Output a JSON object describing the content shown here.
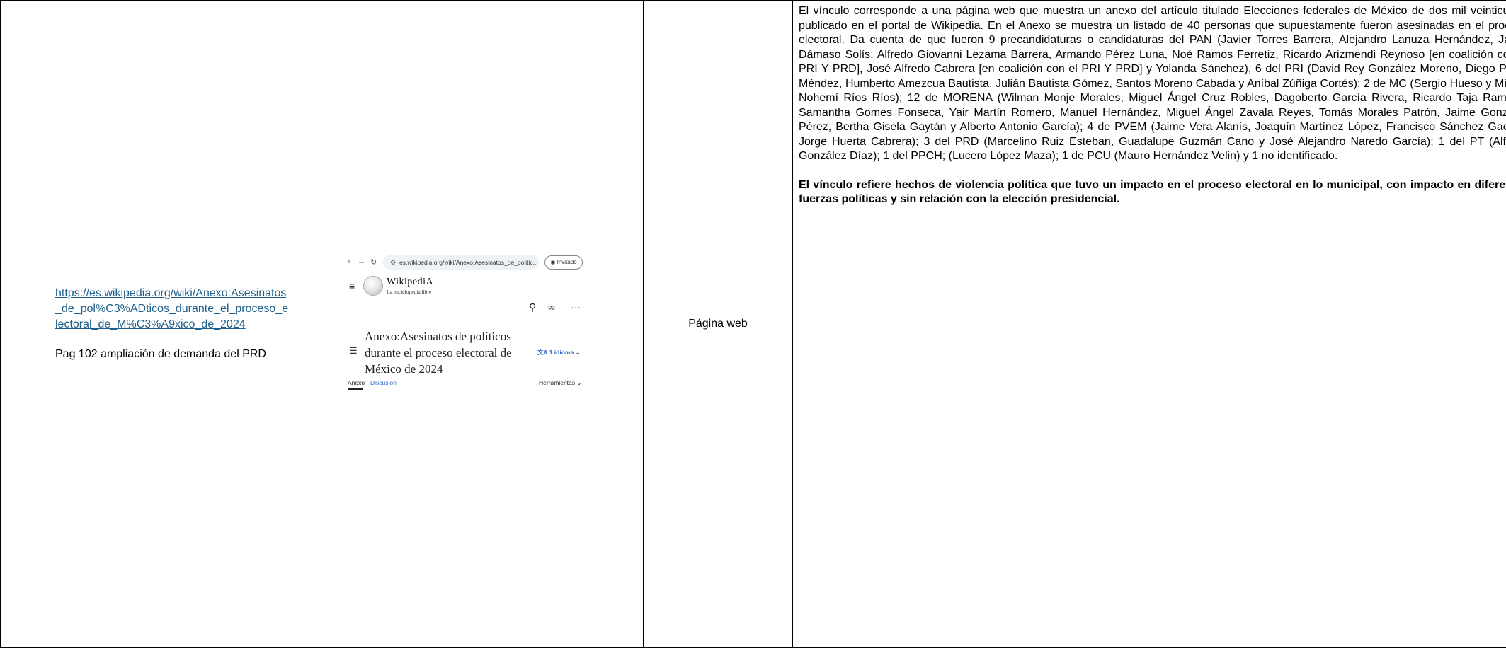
{
  "row": {
    "source_link": "https://es.wikipedia.org/wiki/Anexo:Asesinatos_de_pol%C3%ADticos_durante_el_proceso_electoral_de_M%C3%A9xico_de_2024",
    "source_note": "Pag 102 ampliación de demanda del PRD",
    "type": "Página web",
    "description": "El vínculo corresponde a una página web que muestra un anexo del artículo titulado Elecciones federales de México de dos mil veinticuatro publicado en el portal de Wikipedia. En el Anexo se muestra un listado de 40 personas que supuestamente fueron asesinadas en el proceso electoral. Da cuenta de que fueron 9 precandidaturas o candidaturas del PAN (Javier Torres Barrera, Alejandro Lanuza Hernández, Jaime Dámaso Solís, Alfredo Giovanni Lezama Barrera, Armando Pérez Luna, Noé Ramos Ferretiz, Ricardo Arizmendi Reynoso [en coalición con el PRI Y PRD], José Alfredo Cabrera [en coalición con el PRI Y PRD] y Yolanda Sánchez), 6 del PRI (David Rey González Moreno, Diego Pérez Méndez, Humberto Amezcua Bautista, Julián Bautista Gómez, Santos Moreno Cabada y Aníbal Zúñiga Cortés); 2 de MC (Sergio Hueso y Miriam Nohemí Ríos Ríos); 12 de MORENA (Wilman Monje Morales, Miguel Ángel Cruz Robles, Dagoberto García Rivera, Ricardo Taja Ramírez, Samantha Gomes Fonseca, Yair Martín Romero, Manuel Hernández, Miguel Ángel Zavala Reyes, Tomás Morales Patrón, Jaime González Pérez, Bertha Gisela Gaytán y Alberto Antonio García); 4 de PVEM (Jaime Vera Alanís, Joaquín Martínez López, Francisco Sánchez Gaeta y Jorge Huerta Cabrera); 3 del PRD (Marcelino Ruiz Esteban, Guadalupe Guzmán Cano y José Alejandro Naredo García); 1 del PT (Alfredo González Díaz); 1 del PPCH; (Lucero López Maza); 1 de PCU (Mauro Hernández Velin) y 1 no identificado.",
    "conclusion": "El vínculo refiere hechos de violencia política que tuvo un impacto en el proceso electoral en lo municipal, con impacto en diferentes fuerzas políticas y sin relación con la elección presidencial."
  },
  "screenshot": {
    "url": "es.wikipedia.org/wiki/Anexo:Asesinatos_de_politic...",
    "profile": "Invitado",
    "site_name": "WikipediA",
    "tagline": "La enciclopedia libre",
    "article_title": "Anexo:Asesinatos de políticos durante el proceso electoral de México de 2024",
    "language_button": "1 idioma",
    "tab_article": "Anexo",
    "tab_discussion": "Discusión",
    "tools": "Herramientas",
    "icons": [
      "back-arrow-icon",
      "forward-arrow-icon",
      "reload-icon",
      "site-info-icon",
      "profile-icon",
      "menu-icon",
      "wikipedia-globe-icon",
      "search-icon",
      "reading-glasses-icon",
      "more-icon",
      "toc-icon",
      "translate-icon",
      "chevron-down-icon"
    ]
  }
}
